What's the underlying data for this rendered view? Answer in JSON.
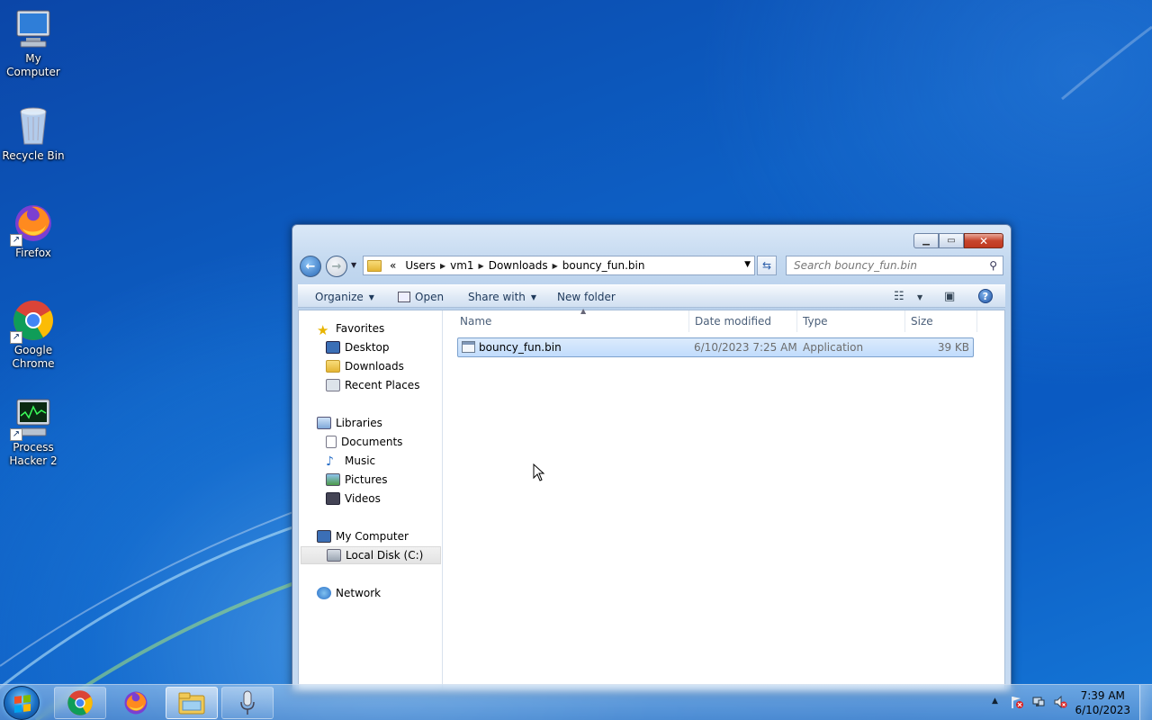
{
  "desktop": {
    "icons": [
      {
        "label_line1": "My",
        "label_line2": "Computer",
        "icon": "computer-icon"
      },
      {
        "label_line1": "Recycle Bin",
        "label_line2": "",
        "icon": "recycle-bin-icon"
      },
      {
        "label_line1": "Firefox",
        "label_line2": "",
        "icon": "firefox-icon"
      },
      {
        "label_line1": "Google",
        "label_line2": "Chrome",
        "icon": "chrome-icon"
      },
      {
        "label_line1": "Process",
        "label_line2": "Hacker 2",
        "icon": "process-hacker-icon"
      }
    ]
  },
  "explorer": {
    "address": {
      "overflow": "«",
      "segments": [
        "Users",
        "vm1",
        "Downloads",
        "bouncy_fun.bin"
      ]
    },
    "search_placeholder": "Search bouncy_fun.bin",
    "toolbar": {
      "organize": "Organize",
      "open": "Open",
      "share_with": "Share with",
      "new_folder": "New folder"
    },
    "nav": {
      "favorites": "Favorites",
      "desktop": "Desktop",
      "downloads": "Downloads",
      "recent": "Recent Places",
      "libraries": "Libraries",
      "documents": "Documents",
      "music": "Music",
      "pictures": "Pictures",
      "videos": "Videos",
      "my_computer": "My Computer",
      "local_disk": "Local Disk (C:)",
      "network": "Network"
    },
    "columns": {
      "name": "Name",
      "date": "Date modified",
      "type": "Type",
      "size": "Size"
    },
    "files": [
      {
        "name": "bouncy_fun.bin",
        "date": "6/10/2023 7:25 AM",
        "type": "Application",
        "size": "39 KB"
      }
    ]
  },
  "taskbar": {
    "time": "7:39 AM",
    "date": "6/10/2023"
  },
  "colors": {
    "selection": "#c1dcfc",
    "accent": "#1e395b"
  }
}
